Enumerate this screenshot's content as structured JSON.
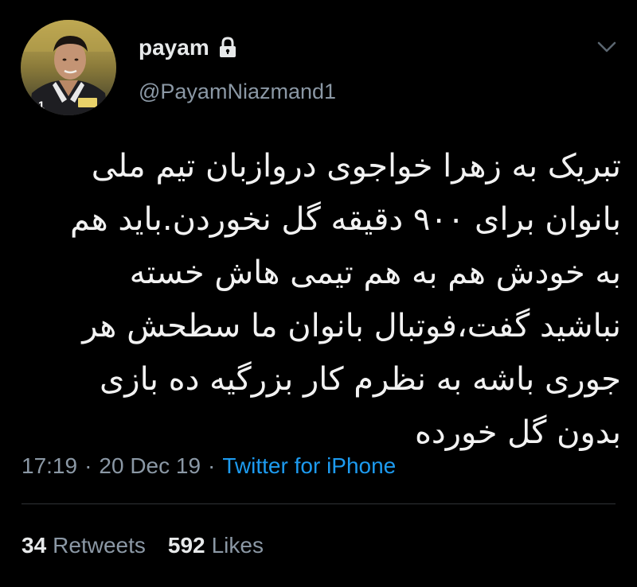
{
  "author": {
    "display_name": "payam",
    "handle": "@PayamNiazmand1",
    "protected_icon": "lock-icon",
    "avatar": "profile-photo-goalkeeper",
    "jersey_number": "1"
  },
  "menu": {
    "icon": "chevron-down-icon"
  },
  "tweet": {
    "lines": [
      "تبریک به زهرا خواجوی دروازبان تیم ملی",
      "بانوان برای ۹۰۰ دقیقه گل نخوردن.باید هم",
      "به خودش هم به هم تیمی هاش خسته",
      "نباشید گفت،فوتبال بانوان ما سطحش هر",
      "جوری باشه به نظرم کار بزرگیه ده بازی",
      "بدون گل خورده"
    ]
  },
  "meta": {
    "time": "17:19",
    "separator": "·",
    "date": "20 Dec 19",
    "source": "Twitter for iPhone"
  },
  "stats": {
    "retweets_count": "34",
    "retweets_label": "Retweets",
    "likes_count": "592",
    "likes_label": "Likes"
  },
  "colors": {
    "background": "#000000",
    "text": "#e7e9ea",
    "muted": "#8b98a5",
    "link": "#1d9bf0",
    "divider": "#2f3336"
  }
}
